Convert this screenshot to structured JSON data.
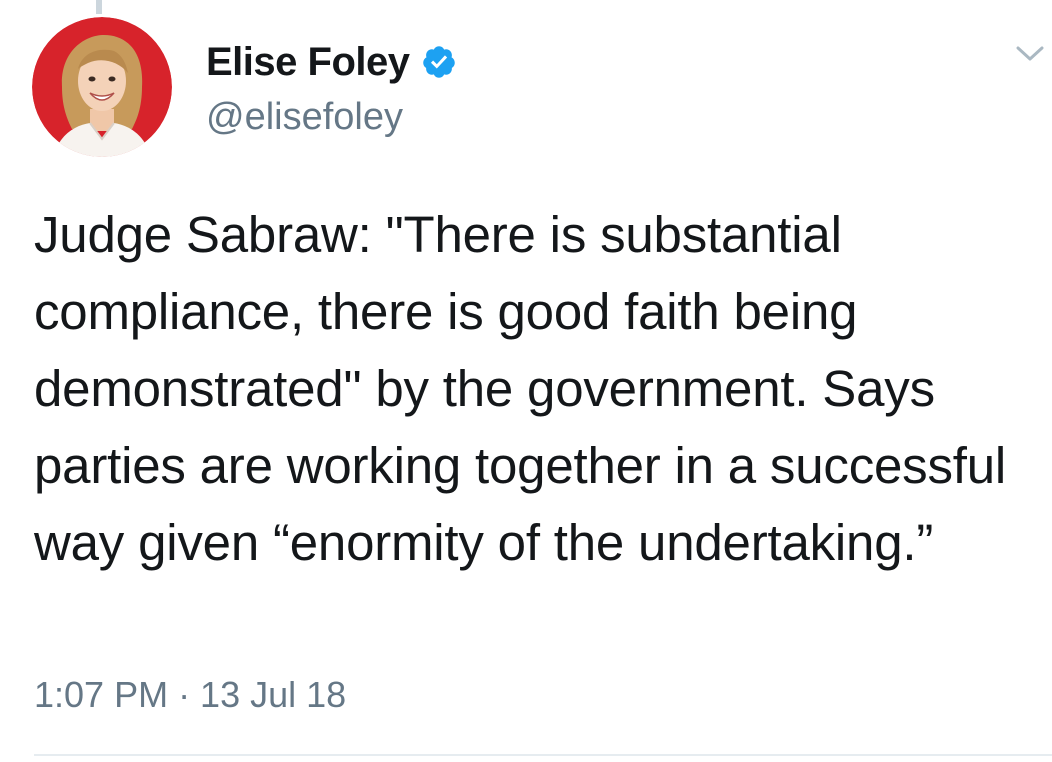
{
  "author": {
    "display_name": "Elise Foley",
    "handle": "@elisefoley",
    "verified": true
  },
  "tweet": {
    "text": "Judge Sabraw: \"There is substantial compliance, there is good faith being demonstrated\" by the government. Says parties are working together in a successful way given “enormity of the undertaking.”",
    "timestamp": "1:07 PM · 13 Jul 18"
  },
  "colors": {
    "text_primary": "#14171a",
    "text_secondary": "#657786",
    "verified_blue": "#1da1f2",
    "avatar_bg": "#d7232b"
  },
  "icons": {
    "verified": "verified-badge-icon",
    "menu": "chevron-down-icon"
  }
}
